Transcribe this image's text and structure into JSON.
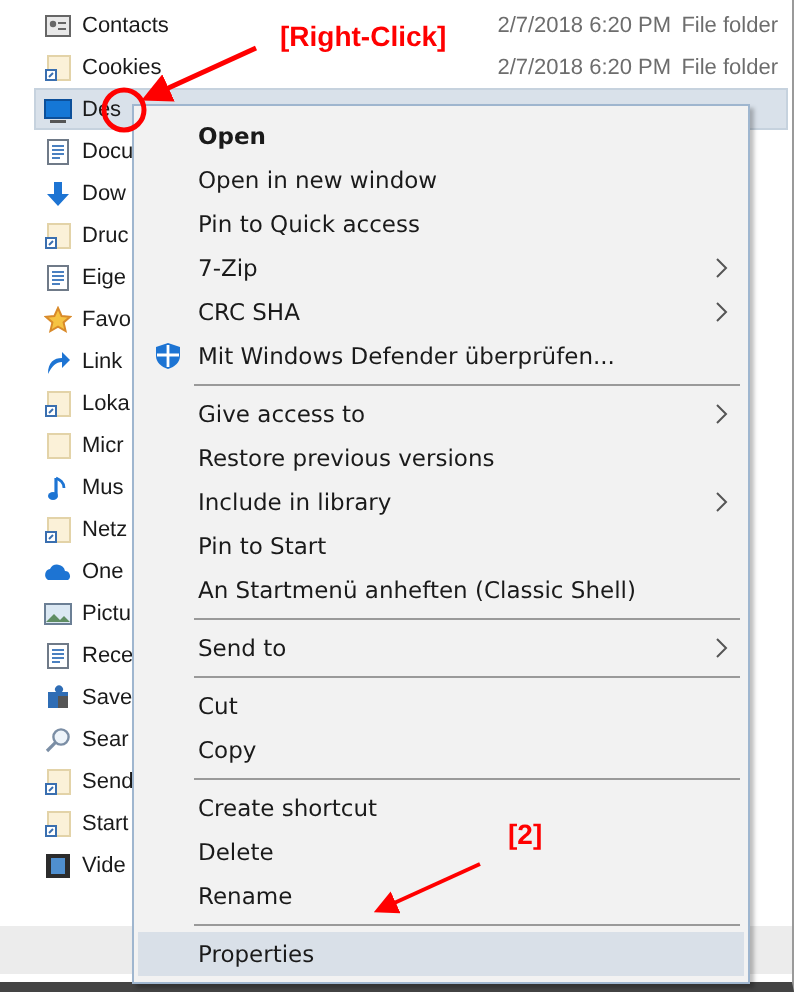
{
  "files": [
    {
      "name": "Contacts",
      "kind": "contact",
      "date": "2/7/2018 6:20 PM",
      "type": "File folder",
      "selected": false
    },
    {
      "name": "Cookies",
      "kind": "shortcut",
      "date": "2/7/2018 6:20 PM",
      "type": "File folder",
      "selected": false
    },
    {
      "name": "Des",
      "kind": "desktop",
      "selected": true
    },
    {
      "name": "Docu",
      "kind": "document",
      "selected": false
    },
    {
      "name": "Dow",
      "kind": "download",
      "selected": false
    },
    {
      "name": "Druc",
      "kind": "shortcut",
      "selected": false
    },
    {
      "name": "Eige",
      "kind": "document",
      "selected": false
    },
    {
      "name": "Favo",
      "kind": "star",
      "selected": false
    },
    {
      "name": "Link",
      "kind": "link",
      "selected": false
    },
    {
      "name": "Loka",
      "kind": "shortcut",
      "selected": false
    },
    {
      "name": "Micr",
      "kind": "folder",
      "selected": false
    },
    {
      "name": "Mus",
      "kind": "music",
      "selected": false
    },
    {
      "name": "Netz",
      "kind": "shortcut",
      "selected": false
    },
    {
      "name": "One",
      "kind": "cloud",
      "selected": false
    },
    {
      "name": "Pictu",
      "kind": "picture",
      "selected": false
    },
    {
      "name": "Rece",
      "kind": "document",
      "selected": false
    },
    {
      "name": "Save",
      "kind": "puzzle",
      "selected": false
    },
    {
      "name": "Sear",
      "kind": "search",
      "selected": false
    },
    {
      "name": "Send",
      "kind": "shortcut",
      "selected": false
    },
    {
      "name": "Start",
      "kind": "shortcut",
      "selected": false
    },
    {
      "name": "Vide",
      "kind": "video",
      "selected": false
    }
  ],
  "context_menu": [
    {
      "kind": "item",
      "label": "Open",
      "bold": true,
      "selected": false
    },
    {
      "kind": "item",
      "label": "Open in new window",
      "selected": false
    },
    {
      "kind": "item",
      "label": "Pin to Quick access",
      "selected": false
    },
    {
      "kind": "item",
      "label": "7-Zip",
      "submenu": true,
      "selected": false
    },
    {
      "kind": "item",
      "label": "CRC SHA",
      "submenu": true,
      "selected": false
    },
    {
      "kind": "shield_item",
      "label": "Mit Windows Defender überprüfen...",
      "selected": false
    },
    {
      "kind": "separator"
    },
    {
      "kind": "item",
      "label": "Give access to",
      "submenu": true,
      "selected": false
    },
    {
      "kind": "item",
      "label": "Restore previous versions",
      "selected": false
    },
    {
      "kind": "item",
      "label": "Include in library",
      "submenu": true,
      "selected": false
    },
    {
      "kind": "item",
      "label": "Pin to Start",
      "selected": false
    },
    {
      "kind": "item",
      "label": "An Startmenü anheften (Classic Shell)",
      "selected": false
    },
    {
      "kind": "separator"
    },
    {
      "kind": "item",
      "label": "Send to",
      "submenu": true,
      "selected": false
    },
    {
      "kind": "separator"
    },
    {
      "kind": "item",
      "label": "Cut",
      "selected": false
    },
    {
      "kind": "item",
      "label": "Copy",
      "selected": false
    },
    {
      "kind": "separator"
    },
    {
      "kind": "item",
      "label": "Create shortcut",
      "selected": false
    },
    {
      "kind": "item",
      "label": "Delete",
      "selected": false
    },
    {
      "kind": "item",
      "label": "Rename",
      "selected": false
    },
    {
      "kind": "separator"
    },
    {
      "kind": "item",
      "label": "Properties",
      "selected": true
    }
  ],
  "annotations": {
    "right_click_label": "[Right-Click]",
    "step_label": "[2]"
  }
}
